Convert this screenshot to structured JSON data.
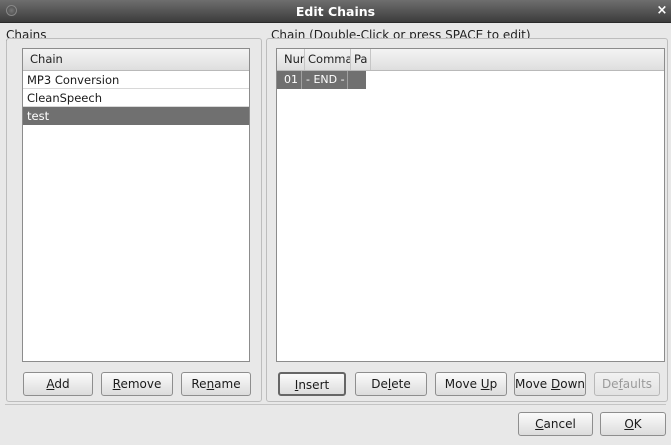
{
  "window": {
    "title": "Edit Chains",
    "close_glyph": "×"
  },
  "chains_panel": {
    "label_mnemonic": "C",
    "label_rest": "hains",
    "column_header": "Chain",
    "items": [
      {
        "label": "MP3 Conversion",
        "selected": false
      },
      {
        "label": "CleanSpeech",
        "selected": false
      },
      {
        "label": "test",
        "selected": true
      }
    ],
    "buttons": {
      "add": {
        "pre": "",
        "mn": "A",
        "post": "dd"
      },
      "remove": {
        "pre": "",
        "mn": "R",
        "post": "emove"
      },
      "rename": {
        "pre": "Re",
        "mn": "n",
        "post": "ame"
      }
    }
  },
  "chain_panel": {
    "label_pre": "C",
    "label_mnemonic": "h",
    "label_rest": "ain (Double-Click or press SPACE to edit)",
    "columns": [
      "Nur",
      "Comma",
      "Pa"
    ],
    "rows": [
      {
        "num": "01",
        "command": "- END -",
        "params": ""
      }
    ],
    "buttons": {
      "insert": {
        "pre": "",
        "mn": "I",
        "post": "nsert"
      },
      "delete": {
        "pre": "De",
        "mn": "l",
        "post": "ete"
      },
      "move_up": {
        "pre": "Move ",
        "mn": "U",
        "post": "p"
      },
      "move_down": {
        "pre": "Move ",
        "mn": "D",
        "post": "own"
      },
      "defaults": {
        "pre": "De",
        "mn": "f",
        "post": "aults"
      }
    }
  },
  "footer": {
    "cancel": {
      "pre": "",
      "mn": "C",
      "post": "ancel"
    },
    "ok": {
      "pre": "",
      "mn": "O",
      "post": "K"
    }
  }
}
